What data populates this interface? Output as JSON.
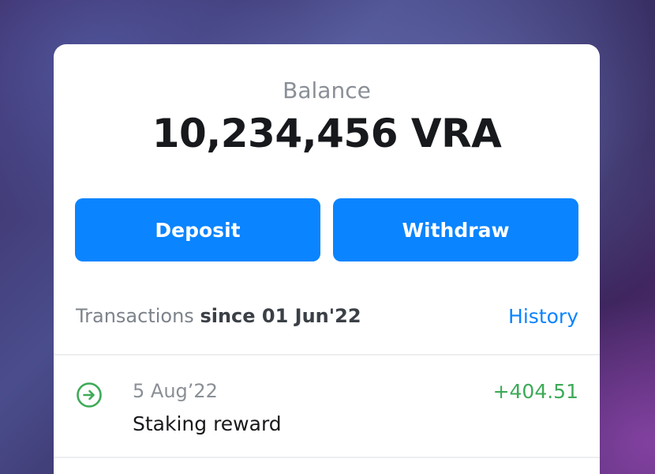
{
  "balance": {
    "label": "Balance",
    "value": "10,234,456 VRA"
  },
  "actions": {
    "deposit_label": "Deposit",
    "withdraw_label": "Withdraw"
  },
  "transactions": {
    "header_prefix": "Transactions",
    "header_since": "since 01 Jun'22",
    "history_label": "History",
    "items": [
      {
        "date": "5 Aug’22",
        "description": "Staking reward",
        "amount": "+404.51",
        "icon": "arrow-right-circle-icon"
      }
    ]
  },
  "colors": {
    "accent": "#0a84ff",
    "positive": "#3daa57",
    "text_primary": "#17191c",
    "text_secondary": "#8a8f96"
  }
}
